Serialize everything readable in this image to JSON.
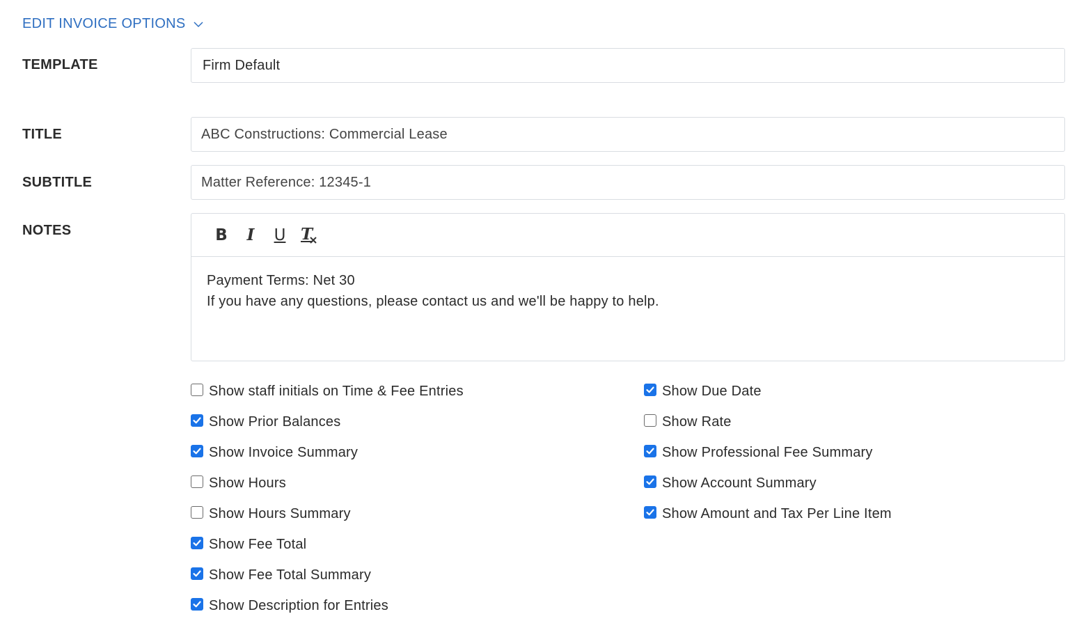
{
  "section": {
    "toggle_label": "EDIT INVOICE OPTIONS",
    "toggle_icon": "chevron-down-icon",
    "accent_color": "#2f6fc1"
  },
  "template": {
    "label": "TEMPLATE",
    "value": "Firm Default"
  },
  "title": {
    "label": "TITLE",
    "value": "ABC Constructions: Commercial Lease"
  },
  "subtitle": {
    "label": "SUBTITLE",
    "value": "Matter Reference: 12345-1"
  },
  "notes": {
    "label": "NOTES",
    "toolbar": {
      "bold": "B",
      "italic": "I",
      "underline": "U",
      "clear_format": "T"
    },
    "lines": [
      "Payment Terms: Net 30",
      "If you have any questions, please contact us and we'll be happy to help."
    ]
  },
  "options": {
    "checkbox_color": "#1a73e8",
    "left": [
      {
        "label": "Show staff initials on Time & Fee Entries",
        "checked": false
      },
      {
        "label": "Show Prior Balances",
        "checked": true
      },
      {
        "label": "Show Invoice Summary",
        "checked": true
      },
      {
        "label": "Show Hours",
        "checked": false
      },
      {
        "label": "Show Hours Summary",
        "checked": false
      },
      {
        "label": "Show Fee Total",
        "checked": true
      },
      {
        "label": "Show Fee Total Summary",
        "checked": true
      },
      {
        "label": "Show Description for Entries",
        "checked": true
      }
    ],
    "right": [
      {
        "label": "Show Due Date",
        "checked": true
      },
      {
        "label": "Show Rate",
        "checked": false
      },
      {
        "label": "Show Professional Fee Summary",
        "checked": true
      },
      {
        "label": "Show Account Summary",
        "checked": true
      },
      {
        "label": "Show Amount and Tax Per Line Item",
        "checked": true
      }
    ]
  }
}
